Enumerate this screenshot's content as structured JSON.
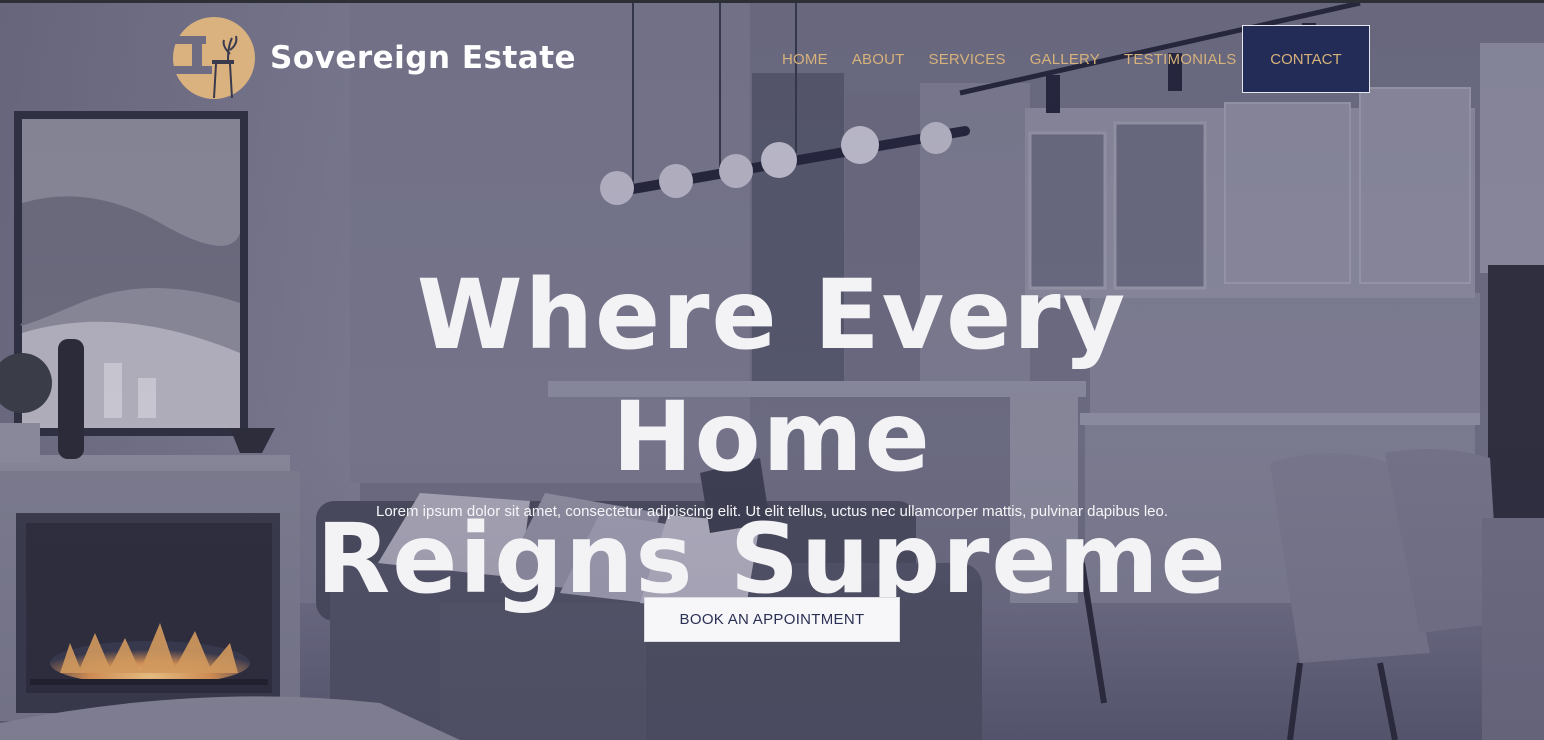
{
  "brand": {
    "name": "Sovereign Estate",
    "logo_icon": "house-chair-logo-icon",
    "logo_color": "#d9b27f"
  },
  "nav": {
    "items": [
      {
        "label": "HOME"
      },
      {
        "label": "ABOUT"
      },
      {
        "label": "SERVICES"
      },
      {
        "label": "GALLERY"
      },
      {
        "label": "TESTIMONIALS"
      }
    ],
    "contact_label": "CONTACT",
    "link_color": "#d7b27b",
    "contact_bg": "#222c56"
  },
  "hero": {
    "headline_line1": "Where Every Home",
    "headline_line2": "Reigns Supreme",
    "subtext": "Lorem ipsum dolor sit amet, consectetur adipiscing elit. Ut elit tellus, uctus nec ullamcorper mattis, pulvinar dapibus leo.",
    "cta_label": "BOOK AN APPOINTMENT",
    "background": "living-room-kitchen-interior-photo",
    "overlay_color": "#3c3c5a"
  }
}
